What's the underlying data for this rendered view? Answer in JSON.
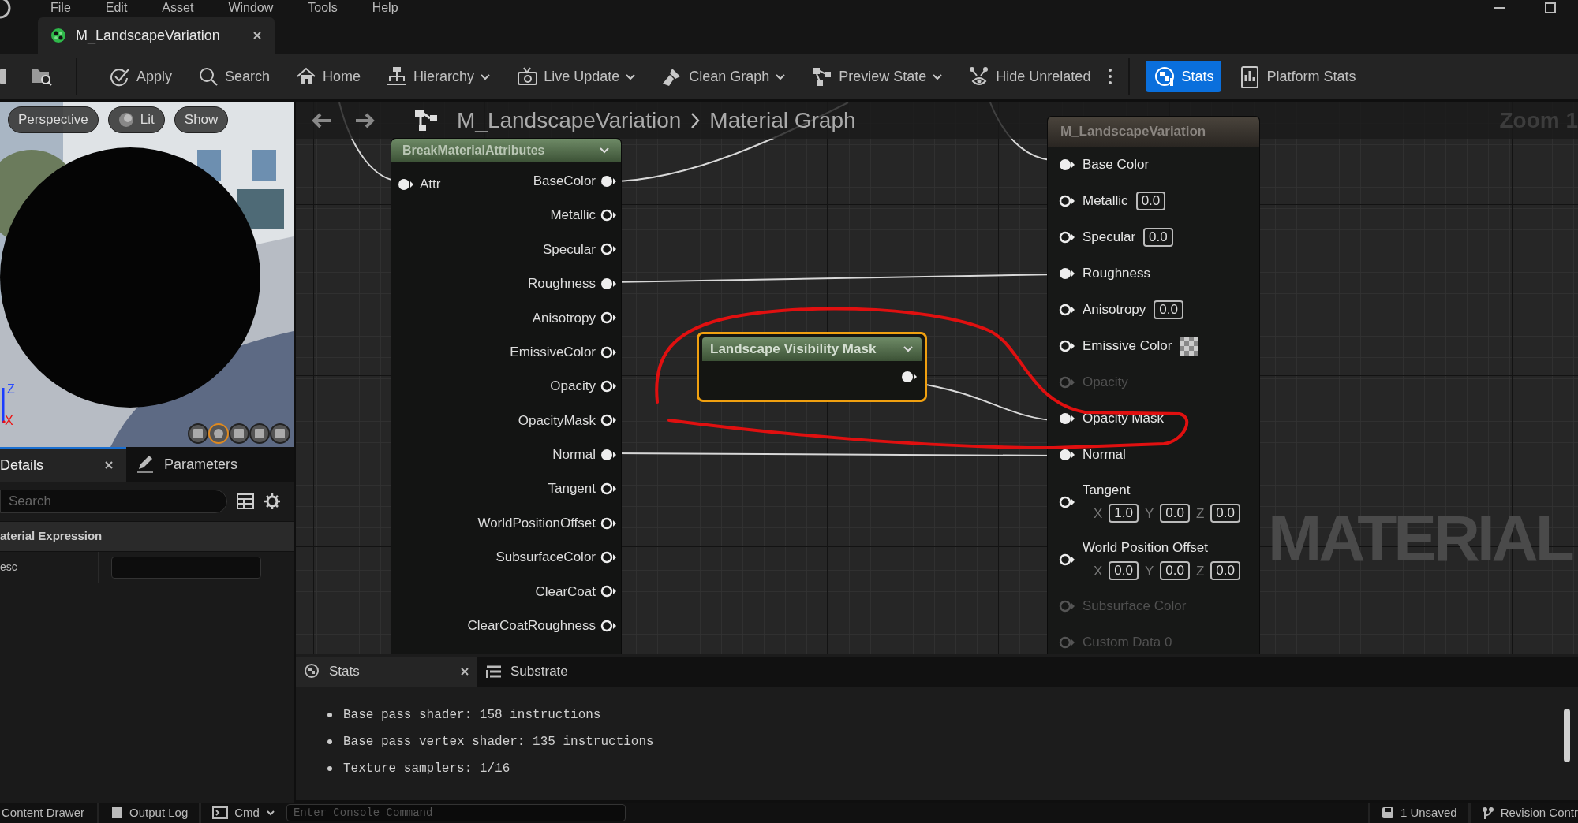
{
  "menu": [
    "File",
    "Edit",
    "Asset",
    "Window",
    "Tools",
    "Help"
  ],
  "document_tab": {
    "title": "M_LandscapeVariation",
    "selected": true
  },
  "toolbar": [
    {
      "label": "Apply",
      "dropdown": false,
      "selected": false
    },
    {
      "label": "Search",
      "dropdown": false,
      "selected": false
    },
    {
      "label": "Home",
      "dropdown": false,
      "selected": false
    },
    {
      "label": "Hierarchy",
      "dropdown": true,
      "selected": false
    },
    {
      "label": "Live Update",
      "dropdown": true,
      "selected": false
    },
    {
      "label": "Clean Graph",
      "dropdown": true,
      "selected": false
    },
    {
      "label": "Preview State",
      "dropdown": true,
      "selected": false
    },
    {
      "label": "Hide Unrelated",
      "dropdown": false,
      "selected": false
    },
    {
      "label": "Stats",
      "dropdown": false,
      "selected": true
    },
    {
      "label": "Platform Stats",
      "dropdown": false,
      "selected": false
    }
  ],
  "viewport": {
    "buttons": [
      "Perspective",
      "Lit",
      "Show"
    ],
    "axes": [
      "Z",
      "X"
    ]
  },
  "details": {
    "tabs": [
      {
        "label": "Details",
        "selected": true,
        "closable": true
      },
      {
        "label": "Parameters",
        "selected": false,
        "closable": false
      }
    ],
    "search": {
      "placeholder": "Search"
    },
    "section": "aterial Expression",
    "rows": [
      {
        "label": "esc",
        "value": ""
      }
    ]
  },
  "graph": {
    "breadcrumb": [
      "M_LandscapeVariation",
      "Material Graph"
    ],
    "zoom": "Zoom 1",
    "watermark": "MATERIAL",
    "break_node": {
      "title": "BreakMaterialAttributes",
      "input": {
        "label": "Attr",
        "connected": true
      },
      "outputs": [
        {
          "label": "BaseColor",
          "connected": true
        },
        {
          "label": "Metallic",
          "connected": false
        },
        {
          "label": "Specular",
          "connected": false
        },
        {
          "label": "Roughness",
          "connected": true
        },
        {
          "label": "Anisotropy",
          "connected": false
        },
        {
          "label": "EmissiveColor",
          "connected": false
        },
        {
          "label": "Opacity",
          "connected": false
        },
        {
          "label": "OpacityMask",
          "connected": false
        },
        {
          "label": "Normal",
          "connected": true
        },
        {
          "label": "Tangent",
          "connected": false
        },
        {
          "label": "WorldPositionOffset",
          "connected": false
        },
        {
          "label": "SubsurfaceColor",
          "connected": false
        },
        {
          "label": "ClearCoat",
          "connected": false
        },
        {
          "label": "ClearCoatRoughness",
          "connected": false
        }
      ]
    },
    "mask_node": {
      "title": "Landscape Visibility Mask",
      "selected": true,
      "output_connected": true
    },
    "result_node": {
      "title": "M_LandscapeVariation",
      "inputs": [
        {
          "label": "Base Color",
          "kind": "plain",
          "connected": true,
          "disabled": false
        },
        {
          "label": "Metallic",
          "kind": "scalar",
          "value": "0.0",
          "connected": false,
          "disabled": false
        },
        {
          "label": "Specular",
          "kind": "scalar",
          "value": "0.0",
          "connected": false,
          "disabled": false
        },
        {
          "label": "Roughness",
          "kind": "plain",
          "connected": true,
          "disabled": false
        },
        {
          "label": "Anisotropy",
          "kind": "scalar",
          "value": "0.0",
          "connected": false,
          "disabled": false
        },
        {
          "label": "Emissive Color",
          "kind": "color",
          "connected": false,
          "disabled": false
        },
        {
          "label": "Opacity",
          "kind": "plain",
          "connected": false,
          "disabled": true
        },
        {
          "label": "Opacity Mask",
          "kind": "plain",
          "connected": true,
          "disabled": false
        },
        {
          "label": "Normal",
          "kind": "plain",
          "connected": true,
          "disabled": false
        },
        {
          "label": "Tangent",
          "kind": "vector",
          "axes": [
            "X",
            "Y",
            "Z"
          ],
          "values": [
            "1.0",
            "0.0",
            "0.0"
          ],
          "connected": false,
          "disabled": false
        },
        {
          "label": "World Position Offset",
          "kind": "vector",
          "axes": [
            "X",
            "Y",
            "Z"
          ],
          "values": [
            "0.0",
            "0.0",
            "0.0"
          ],
          "connected": false,
          "disabled": false
        },
        {
          "label": "Subsurface Color",
          "kind": "plain",
          "connected": false,
          "disabled": true
        },
        {
          "label": "Custom Data 0",
          "kind": "plain",
          "connected": false,
          "disabled": true
        }
      ]
    }
  },
  "stats_panel": {
    "tabs": [
      {
        "label": "Stats",
        "selected": true,
        "closable": true
      },
      {
        "label": "Substrate",
        "selected": false,
        "closable": false
      }
    ],
    "lines": [
      "Base pass shader: 158 instructions",
      "Base pass vertex shader: 135 instructions",
      "Texture samplers: 1/16"
    ]
  },
  "status_bar": {
    "content_drawer": "Content Drawer",
    "output_log": "Output Log",
    "cmd": "Cmd",
    "console": {
      "placeholder": "Enter Console Command"
    },
    "unsaved": "1 Unsaved",
    "revision": "Revision Contr"
  }
}
